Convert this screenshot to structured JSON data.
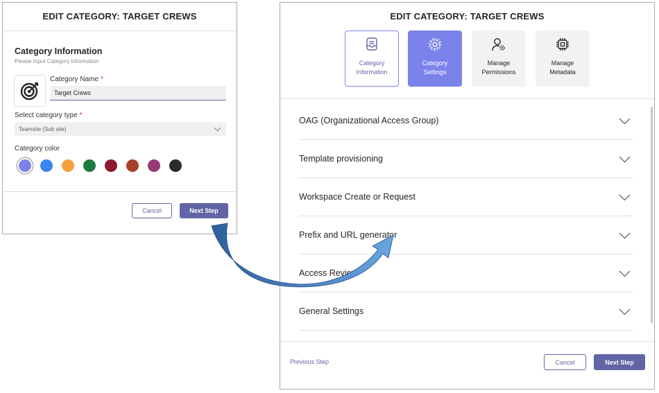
{
  "left_dialog": {
    "title": "EDIT CATEGORY: TARGET CREWS",
    "section_title": "Category Information",
    "section_subtitle": "Please Input Category Information",
    "name_label": "Category Name",
    "name_required": "*",
    "name_value": "Target Crews",
    "type_label": "Select category type",
    "type_required": "*",
    "type_value": "Teamsite (Sub site)",
    "color_label": "Category color",
    "colors": [
      "#7b83eb",
      "#3a86f0",
      "#f5a13c",
      "#1e7b3f",
      "#8b1a2f",
      "#a8402a",
      "#983a76",
      "#2b2b2b"
    ],
    "selected_color": "#7b83eb",
    "category_icon": "target-icon",
    "cancel_label": "Cancel",
    "next_label": "Next Step"
  },
  "right_dialog": {
    "title": "EDIT CATEGORY: TARGET CREWS",
    "tabs": [
      {
        "label": "Category\nInformation",
        "icon": "inbox-icon",
        "state": "visited"
      },
      {
        "label": "Category\nSettings",
        "icon": "gear-icon",
        "state": "active"
      },
      {
        "label": "Manage\nPermissions",
        "icon": "user-gear-icon",
        "state": "default"
      },
      {
        "label": "Manage\nMetadata",
        "icon": "chip-icon",
        "state": "default"
      }
    ],
    "sections": [
      {
        "label": "OAG (Organizational Access Group)"
      },
      {
        "label": "Template provisioning"
      },
      {
        "label": "Workspace Create or Request"
      },
      {
        "label": "Prefix and URL generator"
      },
      {
        "label": "Access Review"
      },
      {
        "label": "General Settings"
      }
    ],
    "previous_label": "Previous Step",
    "cancel_label": "Cancel",
    "next_label": "Next Step"
  },
  "colors": {
    "accent": "#6264a7",
    "active_tab": "#7b83eb",
    "arrow_dark": "#2f5f9a",
    "arrow_light": "#5b9bd5"
  }
}
